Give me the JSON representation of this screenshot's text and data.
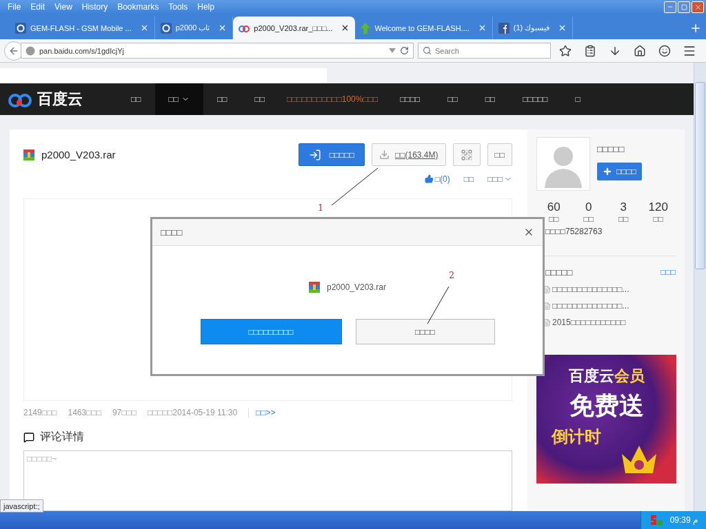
{
  "menu": [
    "File",
    "Edit",
    "View",
    "History",
    "Bookmarks",
    "Tools",
    "Help"
  ],
  "tabs": [
    {
      "title": "GEM-FLASH - GSM Mobile ...",
      "kind": "g",
      "selected": false
    },
    {
      "title": "p2000 تاب",
      "kind": "g",
      "selected": false
    },
    {
      "title": "p2000_V203.rar_□□□...",
      "kind": "cloud",
      "selected": true
    },
    {
      "title": "Welcome to GEM-FLASH....",
      "kind": "arrow",
      "selected": false
    },
    {
      "title": "(1) فيسبوك",
      "kind": "f",
      "selected": false
    }
  ],
  "address": {
    "value": "pan.baidu.com/s/1gdIcjYj"
  },
  "search": {
    "placeholder": "Search"
  },
  "site_nav": {
    "logo_text": "百度云",
    "items": [
      {
        "label": "□□",
        "selected": false,
        "kind": "link"
      },
      {
        "label": "□□",
        "selected": true,
        "kind": "dropdown"
      },
      {
        "label": "□□",
        "selected": false,
        "kind": "link"
      },
      {
        "label": "□□",
        "selected": false,
        "kind": "link"
      },
      {
        "label": "□□□□□□□□□□□100%□□□",
        "selected": false,
        "kind": "promo"
      },
      {
        "label": "□□□□",
        "selected": false,
        "kind": "link"
      },
      {
        "label": "□□",
        "selected": false,
        "kind": "link"
      },
      {
        "label": "□□",
        "selected": false,
        "kind": "link"
      },
      {
        "label": "□□□□□",
        "selected": false,
        "kind": "link"
      },
      {
        "label": "□",
        "selected": false,
        "kind": "link"
      }
    ]
  },
  "file": {
    "name": "p2000_V203.rar",
    "save_button": "□□□□□",
    "download_button": "□□(163.4M)",
    "more_button": "□□",
    "like": "□(0)",
    "action_2": "□□",
    "action_3": "□□□",
    "stats": [
      "2149□□□",
      "1463□□□",
      "97□□□",
      "□□□□□2014-05-19 11:30"
    ],
    "stats_link": "□□>>"
  },
  "comments": {
    "title": "评论详情",
    "placeholder": "□□□□□~"
  },
  "dialog": {
    "title": "□□□□",
    "file_name": "p2000_V203.rar",
    "primary_button": "□□□□□□□□□",
    "secondary_button": "□□□□"
  },
  "annotations": [
    "1",
    "2"
  ],
  "profile": {
    "name": "□□□□□",
    "follow_button": "□□□□",
    "counts": [
      {
        "value": "60",
        "label": "□□"
      },
      {
        "value": "0",
        "label": "□□"
      },
      {
        "value": "3",
        "label": "□□"
      },
      {
        "value": "120",
        "label": "□□"
      }
    ],
    "id_line": "□□□□75282763",
    "section_title": "□□□□□",
    "section_link": "□□□",
    "files": [
      "□□□□□□□□□□□□□□...",
      "□□□□□□□□□□□□□□...",
      "2015□□□□□□□□□□□"
    ]
  },
  "ad": {
    "title": "百度云",
    "title_accent": "会员",
    "headline": "免费送",
    "subline": "倒计时"
  },
  "status_text": "javascript:;",
  "taskbar": {
    "clock": "09:39 م"
  }
}
